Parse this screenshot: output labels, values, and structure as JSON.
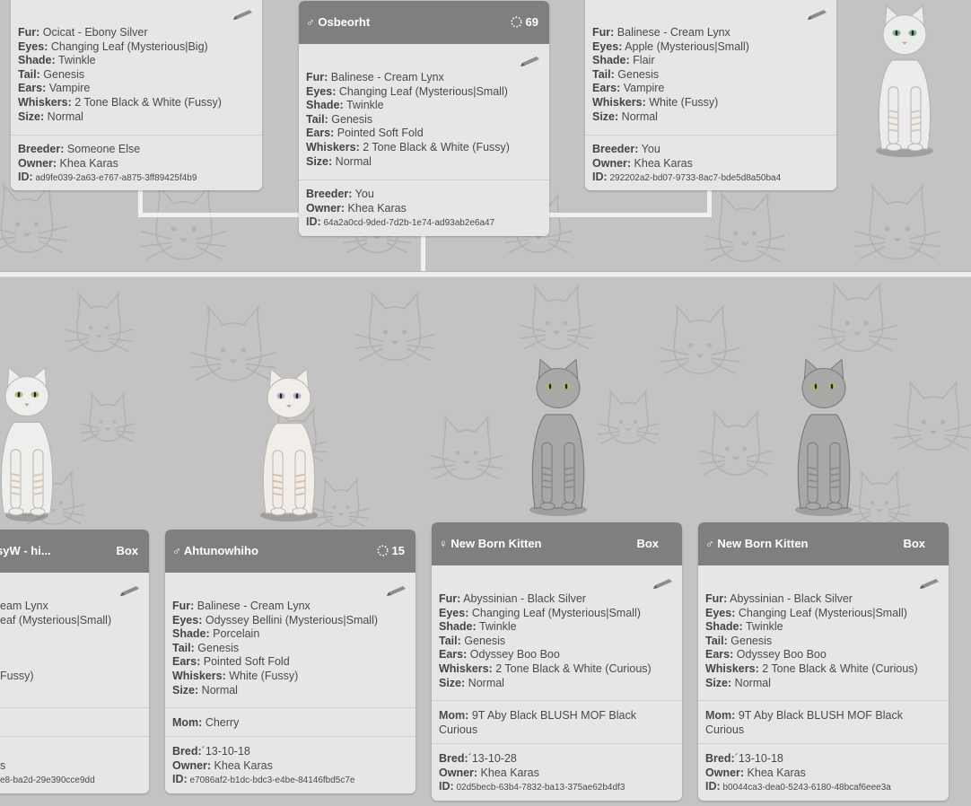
{
  "labels": {
    "fur": "Fur:",
    "eyes": "Eyes:",
    "shade": "Shade:",
    "tail": "Tail:",
    "ears": "Ears:",
    "whiskers": "Whiskers:",
    "size": "Size:",
    "breeder": "Breeder:",
    "owner": "Owner:",
    "id": "ID:",
    "mom": "Mom:",
    "bred": "Bred:"
  },
  "icons": {
    "male": "male-icon",
    "female": "female-icon",
    "generation": "dotted-circle-icon",
    "edit": "pencil-icon",
    "background": "cat-face-pattern"
  },
  "colors": {
    "header": "#7f7f7f",
    "card": "#e6e6e6",
    "background": "#c3c3c3",
    "connector": "#f0f0f0"
  },
  "parents": [
    {
      "fur": "Ocicat - Ebony Silver",
      "eyes": "Changing Leaf (Mysterious|Big)",
      "shade": "Twinkle",
      "tail": "Genesis",
      "ears": "Vampire",
      "whiskers": "2 Tone Black & White (Fussy)",
      "size": "Normal",
      "breeder": "Someone Else",
      "owner": "Khea Karas",
      "id": "ad9fe039-2a63-e767-a875-3ff89425f4b9"
    },
    {
      "sex": "♂",
      "name": "Osbeorht",
      "generation": "69",
      "fur": "Balinese - Cream Lynx",
      "eyes": "Changing Leaf (Mysterious|Small)",
      "shade": "Twinkle",
      "tail": "Genesis",
      "ears": "Pointed Soft Fold",
      "whiskers": "2 Tone Black & White (Fussy)",
      "size": "Normal",
      "breeder": "You",
      "owner": "Khea Karas",
      "id": "64a2a0cd-9ded-7d2b-1e74-ad93ab2e6a47"
    },
    {
      "fur": "Balinese - Cream Lynx",
      "eyes": "Apple (Mysterious|Small)",
      "shade": "Flair",
      "tail": "Genesis",
      "ears": "Vampire",
      "whiskers": "White (Fussy)",
      "size": "Normal",
      "breeder": "You",
      "owner": "Khea Karas",
      "id": "292202a2-bd07-9733-8ac7-bde5d8a50ba4"
    }
  ],
  "kittens": [
    {
      "name_fragment": "syW - hi...",
      "status": "Box",
      "fur_fragment": "eam Lynx",
      "eyes_fragment": "eaf (Mysterious|Small)",
      "whiskers_fragment": "Fussy)",
      "owner_fragment": "s",
      "id_fragment": "e8-ba2d-29e390cce9dd"
    },
    {
      "sex": "♂",
      "name": "Ahtunowhiho",
      "generation": "15",
      "fur": "Balinese - Cream Lynx",
      "eyes": "Odyssey Bellini (Mysterious|Small)",
      "shade": "Porcelain",
      "tail": "Genesis",
      "ears": "Pointed Soft Fold",
      "whiskers": "White (Fussy)",
      "size": "Normal",
      "mom": "Cherry",
      "bred": "´13-10-18",
      "owner": "Khea Karas",
      "id": "e7086af2-b1dc-bdc3-e4be-84146fbd5c7e"
    },
    {
      "sex": "♀",
      "name": "New Born Kitten",
      "status": "Box",
      "fur": "Abyssinian - Black Silver",
      "eyes": "Changing Leaf (Mysterious|Small)",
      "shade": "Twinkle",
      "tail": "Genesis",
      "ears": "Odyssey Boo Boo",
      "whiskers": "2 Tone Black & White (Curious)",
      "size": "Normal",
      "mom": "9T Aby Black BLUSH MOF Black Curious",
      "bred": "´13-10-28",
      "owner": "Khea Karas",
      "id": "02d5becb-63b4-7832-ba13-375ae62b4df3"
    },
    {
      "sex": "♂",
      "name": "New Born Kitten",
      "status": "Box",
      "fur": "Abyssinian - Black Silver",
      "eyes": "Changing Leaf (Mysterious|Small)",
      "shade": "Twinkle",
      "tail": "Genesis",
      "ears": "Odyssey Boo Boo",
      "whiskers": "2 Tone Black & White (Curious)",
      "size": "Normal",
      "mom": "9T Aby Black BLUSH MOF Black Curious",
      "bred": "´13-10-18",
      "owner": "Khea Karas",
      "id": "b0044ca3-dea0-5243-6180-48bcaf6eee3a"
    }
  ]
}
